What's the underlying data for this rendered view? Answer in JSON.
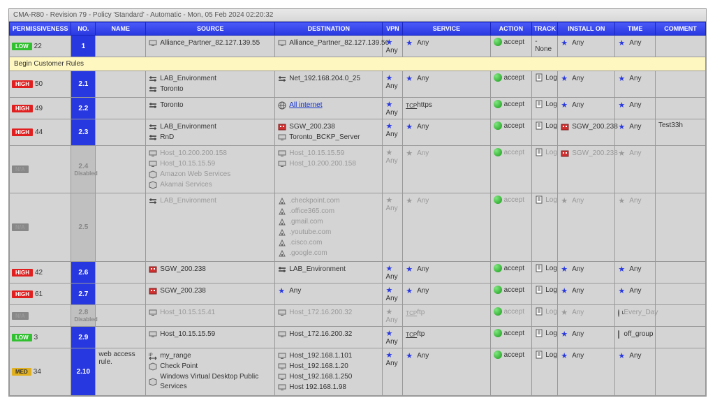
{
  "title": "CMA-R80 - Revision 79 - Policy 'Standard' - Automatic - Mon, 05 Feb 2024 02:20:32",
  "columns": {
    "permissiveness": "PERMISSIVENESS",
    "no": "NO.",
    "name": "NAME",
    "source": "SOURCE",
    "destination": "DESTINATION",
    "vpn": "VPN",
    "service": "SERVICE",
    "action": "ACTION",
    "track": "TRACK",
    "install_on": "INSTALL ON",
    "time": "TIME",
    "comment": "COMMENT"
  },
  "section_label": "Begin Customer Rules",
  "labels": {
    "any": "Any",
    "accept": "accept",
    "log": "Log",
    "none": "- None",
    "disabled": "Disabled"
  },
  "rows": [
    {
      "perm_level": "LOW",
      "perm_count": "22",
      "no": "1",
      "name": "",
      "source": [
        {
          "icon": "host",
          "text": "Alliance_Partner_82.127.139.55"
        }
      ],
      "destination": [
        {
          "icon": "host",
          "text": "Alliance_Partner_82.127.139.56"
        }
      ],
      "vpn": "any",
      "service": [
        {
          "type": "any"
        }
      ],
      "action": "accept",
      "track": "none",
      "install_on": [
        {
          "type": "any"
        }
      ],
      "time": [
        {
          "type": "any"
        }
      ],
      "comment": ""
    },
    {
      "section": true
    },
    {
      "perm_level": "HIGH",
      "perm_count": "50",
      "no": "2.1",
      "name": "",
      "source": [
        {
          "icon": "network",
          "text": "LAB_Environment"
        },
        {
          "icon": "network",
          "text": "Toronto"
        }
      ],
      "destination": [
        {
          "icon": "network",
          "text": "Net_192.168.204.0_25"
        }
      ],
      "vpn": "any",
      "service": [
        {
          "type": "any"
        }
      ],
      "action": "accept",
      "track": "log",
      "install_on": [
        {
          "type": "any"
        }
      ],
      "time": [
        {
          "type": "any"
        }
      ],
      "comment": ""
    },
    {
      "perm_level": "HIGH",
      "perm_count": "49",
      "no": "2.2",
      "name": "",
      "source": [
        {
          "icon": "network",
          "text": "Toronto"
        }
      ],
      "destination": [
        {
          "icon": "globe",
          "text": "All internet",
          "link": true
        }
      ],
      "vpn": "any",
      "service": [
        {
          "icon": "tcp",
          "text": "https"
        }
      ],
      "action": "accept",
      "track": "log",
      "install_on": [
        {
          "type": "any"
        }
      ],
      "time": [
        {
          "type": "any"
        }
      ],
      "comment": ""
    },
    {
      "perm_level": "HIGH",
      "perm_count": "44",
      "no": "2.3",
      "name": "",
      "source": [
        {
          "icon": "network",
          "text": "LAB_Environment"
        },
        {
          "icon": "network",
          "text": "RnD"
        }
      ],
      "destination": [
        {
          "icon": "gateway",
          "text": "SGW_200.238"
        },
        {
          "icon": "host",
          "text": "Toronto_BCKP_Server"
        }
      ],
      "vpn": "any",
      "service": [
        {
          "type": "any"
        }
      ],
      "action": "accept",
      "track": "log",
      "install_on": [
        {
          "icon": "gateway",
          "text": "SGW_200.238"
        }
      ],
      "time": [
        {
          "type": "any"
        }
      ],
      "comment": "Test33h"
    },
    {
      "dimmed": true,
      "perm_level": "NA",
      "perm_count": "",
      "no": "2.4",
      "no_disabled": true,
      "name": "",
      "source": [
        {
          "icon": "host",
          "text": "Host_10.200.200.158"
        },
        {
          "icon": "host",
          "text": "Host_10.15.15.59"
        },
        {
          "icon": "group",
          "text": "Amazon Web Services"
        },
        {
          "icon": "group",
          "text": "Akamai Services"
        }
      ],
      "destination": [
        {
          "icon": "host",
          "text": "Host_10.15.15.59"
        },
        {
          "icon": "host",
          "text": "Host_10.200.200.158"
        }
      ],
      "vpn": "any",
      "service": [
        {
          "type": "any"
        }
      ],
      "action": "accept",
      "track": "log",
      "install_on": [
        {
          "icon": "gateway",
          "text": "SGW_200.238"
        }
      ],
      "time": [
        {
          "type": "any"
        }
      ],
      "comment": ""
    },
    {
      "dimmed": true,
      "perm_level": "NA",
      "perm_count": "",
      "no": "2.5",
      "name": "",
      "source": [
        {
          "icon": "network",
          "text": "LAB_Environment"
        }
      ],
      "destination": [
        {
          "icon": "domain",
          "text": ".checkpoint.com"
        },
        {
          "icon": "domain",
          "text": ".office365.com"
        },
        {
          "icon": "domain",
          "text": ".gmail.com"
        },
        {
          "icon": "domain",
          "text": ".youtube.com"
        },
        {
          "icon": "domain",
          "text": ".cisco.com"
        },
        {
          "icon": "domain",
          "text": ".google.com"
        }
      ],
      "vpn": "any",
      "service": [
        {
          "type": "any"
        }
      ],
      "action": "accept",
      "track": "log",
      "install_on": [
        {
          "type": "any"
        }
      ],
      "time": [
        {
          "type": "any"
        }
      ],
      "comment": ""
    },
    {
      "perm_level": "HIGH",
      "perm_count": "42",
      "no": "2.6",
      "name": "",
      "source": [
        {
          "icon": "gateway",
          "text": "SGW_200.238"
        }
      ],
      "destination": [
        {
          "icon": "network",
          "text": "LAB_Environment"
        }
      ],
      "vpn": "any",
      "service": [
        {
          "type": "any"
        }
      ],
      "action": "accept",
      "track": "log",
      "install_on": [
        {
          "type": "any"
        }
      ],
      "time": [
        {
          "type": "any"
        }
      ],
      "comment": ""
    },
    {
      "perm_level": "HIGH",
      "perm_count": "61",
      "no": "2.7",
      "name": "",
      "source": [
        {
          "icon": "gateway",
          "text": "SGW_200.238"
        }
      ],
      "destination": [
        {
          "type": "any"
        }
      ],
      "vpn": "any",
      "service": [
        {
          "type": "any"
        }
      ],
      "action": "accept",
      "track": "log",
      "install_on": [
        {
          "type": "any"
        }
      ],
      "time": [
        {
          "type": "any"
        }
      ],
      "comment": ""
    },
    {
      "dimmed": true,
      "perm_level": "NA",
      "perm_count": "",
      "no": "2.8",
      "no_disabled": true,
      "name": "",
      "source": [
        {
          "icon": "host",
          "text": "Host_10.15.15.41"
        }
      ],
      "destination": [
        {
          "icon": "host",
          "text": "Host_172.16.200.32"
        }
      ],
      "vpn": "any",
      "service": [
        {
          "icon": "tcp",
          "text": "ftp"
        }
      ],
      "action": "accept",
      "track": "log",
      "install_on": [
        {
          "type": "any"
        }
      ],
      "time": [
        {
          "icon": "clock",
          "text": "Every_Day"
        }
      ],
      "comment": ""
    },
    {
      "perm_level": "LOW",
      "perm_count": "3",
      "no": "2.9",
      "name": "",
      "source": [
        {
          "icon": "host",
          "text": "Host_10.15.15.59"
        }
      ],
      "destination": [
        {
          "icon": "host",
          "text": "Host_172.16.200.32"
        }
      ],
      "vpn": "any",
      "service": [
        {
          "icon": "tcp",
          "text": "ftp"
        }
      ],
      "action": "accept",
      "track": "log",
      "install_on": [
        {
          "type": "any"
        }
      ],
      "time": [
        {
          "icon": "cal",
          "text": "off_group"
        }
      ],
      "comment": ""
    },
    {
      "perm_level": "MED",
      "perm_count": "34",
      "no": "2.10",
      "name": "web access rule.",
      "source": [
        {
          "icon": "range",
          "text": "my_range"
        },
        {
          "icon": "group",
          "text": "Check Point"
        },
        {
          "icon": "group",
          "text": "Windows Virtual Desktop Public Services"
        }
      ],
      "destination": [
        {
          "icon": "host",
          "text": "Host_192.168.1.101"
        },
        {
          "icon": "host",
          "text": "Host_192.168.1.20"
        },
        {
          "icon": "host",
          "text": "Host_192.168.1.250"
        },
        {
          "icon": "host",
          "text": "Host 192.168.1.98"
        }
      ],
      "vpn": "any",
      "service": [
        {
          "type": "any"
        }
      ],
      "action": "accept",
      "track": "log",
      "install_on": [
        {
          "type": "any"
        }
      ],
      "time": [
        {
          "type": "any"
        }
      ],
      "comment": ""
    }
  ]
}
